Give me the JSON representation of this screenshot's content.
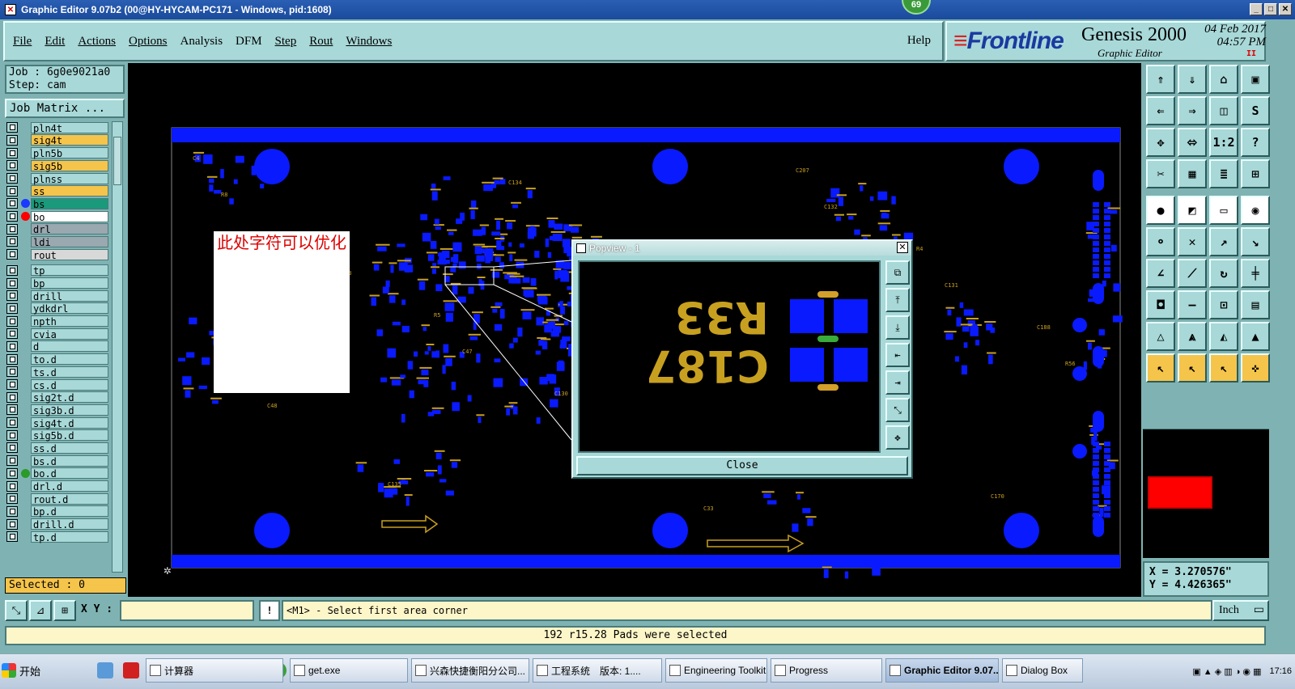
{
  "window": {
    "title": "Graphic Editor 9.07b2 (00@HY-HYCAM-PC171 - Windows, pid:1608)",
    "badge": "69"
  },
  "menu": {
    "items": [
      "File",
      "Edit",
      "Actions",
      "Options",
      "Analysis",
      "DFM",
      "Step",
      "Rout",
      "Windows"
    ],
    "help": "Help"
  },
  "brand": {
    "logo": "Frontline",
    "product": "Genesis 2000",
    "subtitle": "Graphic Editor",
    "date": "04 Feb 2017",
    "time": "04:57 PM",
    "indicator": "II"
  },
  "job": {
    "job_label": "Job : 6g0e9021a0",
    "step_label": "Step: cam",
    "matrix_button": "Job Matrix ..."
  },
  "layers": [
    {
      "name": "pln4t",
      "color": "#a8d8d8",
      "dot": "",
      "arrow": ""
    },
    {
      "name": "sig4t",
      "color": "#f5c44a",
      "dot": "",
      "arrow": "⬋"
    },
    {
      "name": "pln5b",
      "color": "#a8d8d8",
      "dot": "",
      "arrow": ""
    },
    {
      "name": "sig5b",
      "color": "#f5c44a",
      "dot": "",
      "arrow": "⬋"
    },
    {
      "name": "plnss",
      "color": "#a8d8d8",
      "dot": "",
      "arrow": ""
    },
    {
      "name": "ss",
      "color": "#f5c44a",
      "dot": "",
      "arrow": "⬋"
    },
    {
      "name": "bs",
      "color": "#1a9a7a",
      "dot": "#1a3aff",
      "arrow": ""
    },
    {
      "name": "bo",
      "color": "#ffffff",
      "dot": "#ff0000",
      "arrow": "⬋≡"
    },
    {
      "name": "drl",
      "color": "#9aa8b0",
      "dot": "",
      "arrow": ""
    },
    {
      "name": "ldi",
      "color": "#9aa8b0",
      "dot": "",
      "arrow": ""
    },
    {
      "name": "rout",
      "color": "#d8d8d8",
      "dot": "",
      "arrow": ""
    },
    {
      "name": "tp",
      "color": "#a8d8d8",
      "dot": "",
      "arrow": ""
    },
    {
      "name": "bp",
      "color": "#a8d8d8",
      "dot": "",
      "arrow": ""
    },
    {
      "name": "drill",
      "color": "#a8d8d8",
      "dot": "",
      "arrow": ""
    },
    {
      "name": "ydkdrl",
      "color": "#a8d8d8",
      "dot": "",
      "arrow": ""
    },
    {
      "name": "npth",
      "color": "#a8d8d8",
      "dot": "",
      "arrow": ""
    },
    {
      "name": "cvia",
      "color": "#a8d8d8",
      "dot": "",
      "arrow": ""
    },
    {
      "name": "d",
      "color": "#a8d8d8",
      "dot": "",
      "arrow": ""
    },
    {
      "name": "to.d",
      "color": "#a8d8d8",
      "dot": "",
      "arrow": "⬋"
    },
    {
      "name": "ts.d",
      "color": "#a8d8d8",
      "dot": "",
      "arrow": "⬋"
    },
    {
      "name": "cs.d",
      "color": "#a8d8d8",
      "dot": "",
      "arrow": "⬋"
    },
    {
      "name": "sig2t.d",
      "color": "#a8d8d8",
      "dot": "",
      "arrow": "⬋"
    },
    {
      "name": "sig3b.d",
      "color": "#a8d8d8",
      "dot": "",
      "arrow": "⬋"
    },
    {
      "name": "sig4t.d",
      "color": "#a8d8d8",
      "dot": "",
      "arrow": "⬋"
    },
    {
      "name": "sig5b.d",
      "color": "#a8d8d8",
      "dot": "",
      "arrow": "⬋"
    },
    {
      "name": "ss.d",
      "color": "#a8d8d8",
      "dot": "",
      "arrow": "⬋"
    },
    {
      "name": "bs.d",
      "color": "#a8d8d8",
      "dot": "",
      "arrow": ""
    },
    {
      "name": "bo.d",
      "color": "#a8d8d8",
      "dot": "#2a9a2a",
      "arrow": "⬋"
    },
    {
      "name": "drl.d",
      "color": "#a8d8d8",
      "dot": "",
      "arrow": ""
    },
    {
      "name": "rout.d",
      "color": "#a8d8d8",
      "dot": "",
      "arrow": ""
    },
    {
      "name": "bp.d",
      "color": "#a8d8d8",
      "dot": "",
      "arrow": ""
    },
    {
      "name": "drill.d",
      "color": "#a8d8d8",
      "dot": "",
      "arrow": ""
    },
    {
      "name": "tp.d",
      "color": "#a8d8d8",
      "dot": "",
      "arrow": ""
    }
  ],
  "selected": "Selected : 0",
  "note": "此处字符可以优化",
  "popview": {
    "title": "Popview - 1",
    "close_label": "Close",
    "labels": [
      "R33",
      "C187"
    ]
  },
  "board_labels": {
    "designators": [
      "C4",
      "C89",
      "R5",
      "C130",
      "C185",
      "C207",
      "R4",
      "C188",
      "C48",
      "C135",
      "C134",
      "C45",
      "C54",
      "C36",
      "C170",
      "R8",
      "C53",
      "C47",
      "C52",
      "C33",
      "C132",
      "C131",
      "R56"
    ]
  },
  "coords": {
    "x": "X =  3.270576\"",
    "y": "Y =  4.426365\""
  },
  "bottom": {
    "xy_label": "X Y :",
    "xy_value": "",
    "exclaim": "!",
    "message": "<M1> - Select first area corner",
    "unit": "Inch",
    "status": "192 r15.28 Pads were selected"
  },
  "taskbar": {
    "start": "开始",
    "items": [
      {
        "label": "计算器",
        "active": false
      },
      {
        "label": "get.exe",
        "active": false
      },
      {
        "label": "兴森快捷衡阳分公司...",
        "active": false
      },
      {
        "label": "工程系统　版本: 1....",
        "active": false
      },
      {
        "label": "Engineering Toolkit 9....",
        "active": false
      },
      {
        "label": "Progress",
        "active": false
      },
      {
        "label": "Graphic Editor 9.07...",
        "active": true
      },
      {
        "label": "Dialog Box",
        "active": false
      }
    ],
    "clock": "17:16"
  },
  "colors": {
    "pad": "#0a1aff",
    "silk": "#c8a020",
    "bg": "#000000",
    "panel": "#a8d8d8",
    "accent": "#f5c44a"
  }
}
